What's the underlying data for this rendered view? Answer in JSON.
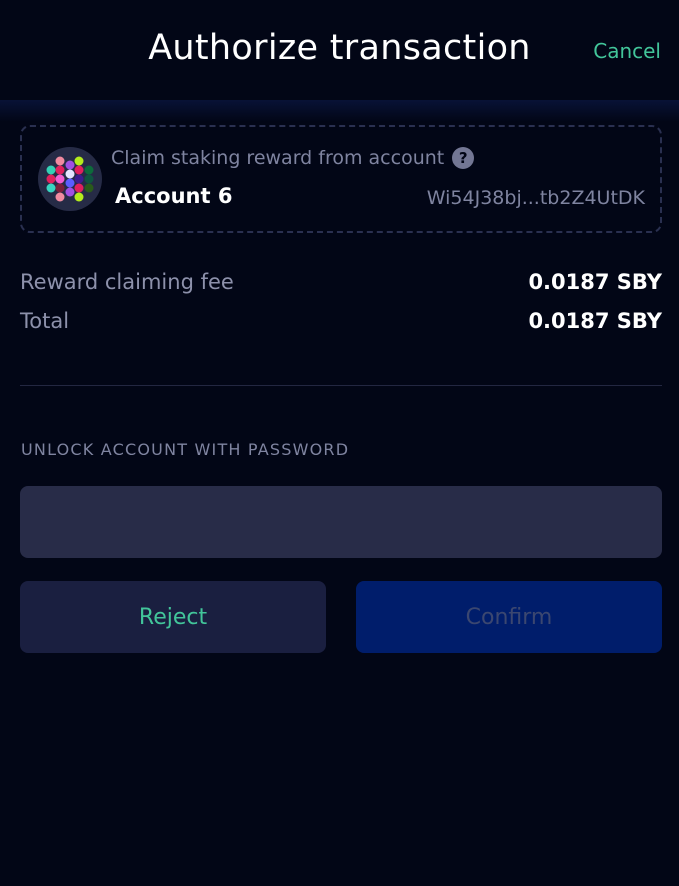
{
  "header": {
    "title": "Authorize transaction",
    "cancel_label": "Cancel"
  },
  "account": {
    "action_text": "Claim staking reward from account",
    "help_icon": "question-circle-icon",
    "name": "Account 6",
    "address": "Wi54J38bj...tb2Z4UtDK",
    "avatar_icon": "identicon-icon"
  },
  "fees": [
    {
      "label": "Reward claiming fee",
      "amount": "0.0187",
      "unit": "SBY"
    },
    {
      "label": "Total",
      "amount": "0.0187",
      "unit": "SBY"
    }
  ],
  "password": {
    "label": "UNLOCK ACCOUNT WITH PASSWORD",
    "value": "",
    "placeholder": ""
  },
  "buttons": {
    "reject_label": "Reject",
    "confirm_label": "Confirm"
  },
  "colors": {
    "background": "#020616",
    "accent_green": "#42c59a",
    "input_bg": "#282c48",
    "confirm_bg": "#001d6b",
    "reject_bg": "#1a1f40"
  }
}
